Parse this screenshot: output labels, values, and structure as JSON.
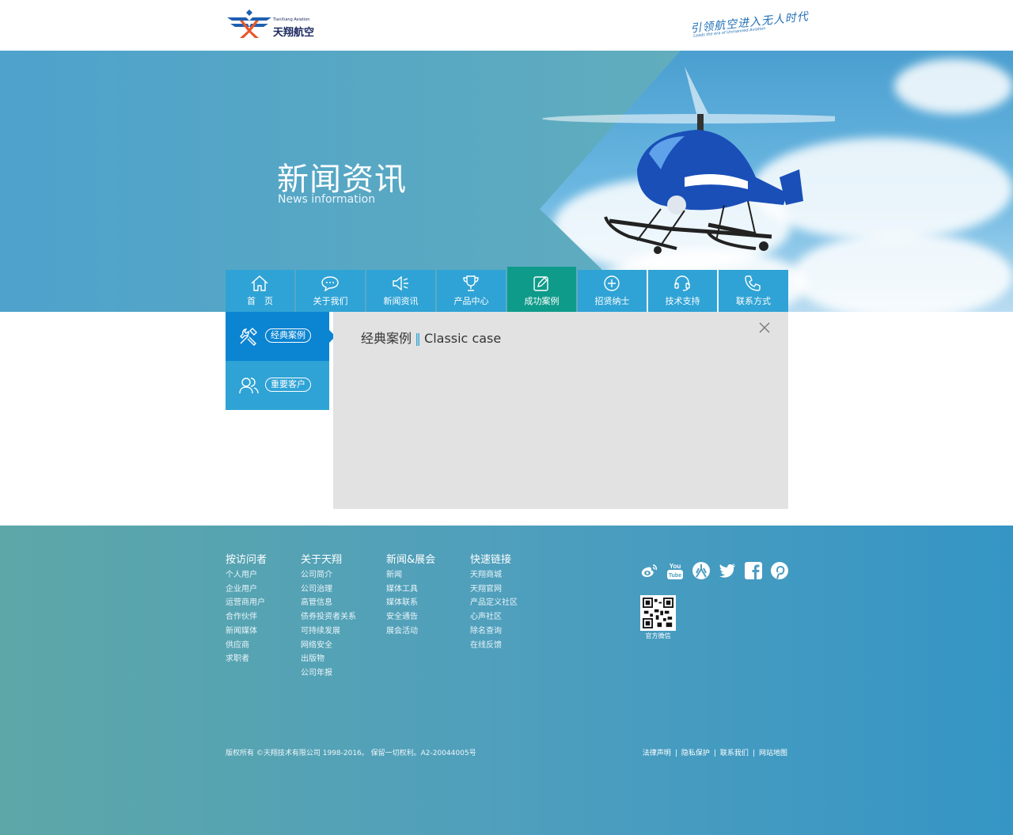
{
  "header": {
    "logo_text": "天翔航空",
    "logo_subtext": "TianXiang Aviation",
    "slogan": "引领航空进入无人时代",
    "slogan_sub": "Leads the era of Unmanned Aviation"
  },
  "banner": {
    "title": "新闻资讯",
    "subtitle": "News information"
  },
  "nav": [
    {
      "label": "首　页",
      "icon": "home-icon"
    },
    {
      "label": "关于我们",
      "icon": "chat-icon"
    },
    {
      "label": "新闻资讯",
      "icon": "speaker-icon"
    },
    {
      "label": "产品中心",
      "icon": "trophy-icon"
    },
    {
      "label": "成功案例",
      "icon": "edit-icon",
      "active": true
    },
    {
      "label": "招贤纳士",
      "icon": "plus-circle-icon"
    },
    {
      "label": "技术支持",
      "icon": "headset-icon"
    },
    {
      "label": "联系方式",
      "icon": "phone-icon"
    }
  ],
  "sidebar": [
    {
      "label": "经典案例",
      "icon": "tools-icon",
      "active": true
    },
    {
      "label": "重要客户",
      "icon": "users-icon"
    }
  ],
  "content": {
    "title_cn": "经典案例",
    "separator": "‖",
    "title_en": "Classic case"
  },
  "footer": {
    "columns": [
      {
        "title": "按访问者",
        "links": [
          "个人用户",
          "企业用户",
          "运营商用户",
          "合作伙伴",
          "新闻媒体",
          "供应商",
          "求职者"
        ]
      },
      {
        "title": "关于天翔",
        "links": [
          "公司简介",
          "公司治理",
          "高管信息",
          "债券投资者关系",
          "可持续发展",
          "网络安全",
          "出版物",
          "公司年报"
        ]
      },
      {
        "title": "新闻&展会",
        "links": [
          "新闻",
          "媒体工具",
          "媒体联系",
          "安全通告",
          "展会活动"
        ]
      },
      {
        "title": "快速链接",
        "links": [
          "天翔商城",
          "天翔官网",
          "产品定义社区",
          "心声社区",
          "除名查询",
          "在线反馈"
        ]
      }
    ],
    "social": [
      "weibo-icon",
      "youtube-icon",
      "renren-icon",
      "twitter-icon",
      "facebook-icon",
      "pinterest-icon"
    ],
    "qr_label": "官方微信",
    "copyright": "版权所有 ©天翔技术有限公司 1998-2016。 保留一切权利。A2-20044005号",
    "links": [
      "法律声明",
      "隐私保护",
      "联系我们",
      "网站地图"
    ]
  },
  "colors": {
    "nav_blue": "#2fa3d5",
    "nav_active": "#0f9b8a",
    "sidebar_active": "#0b84d2",
    "content_bg": "#e2e2e2"
  }
}
